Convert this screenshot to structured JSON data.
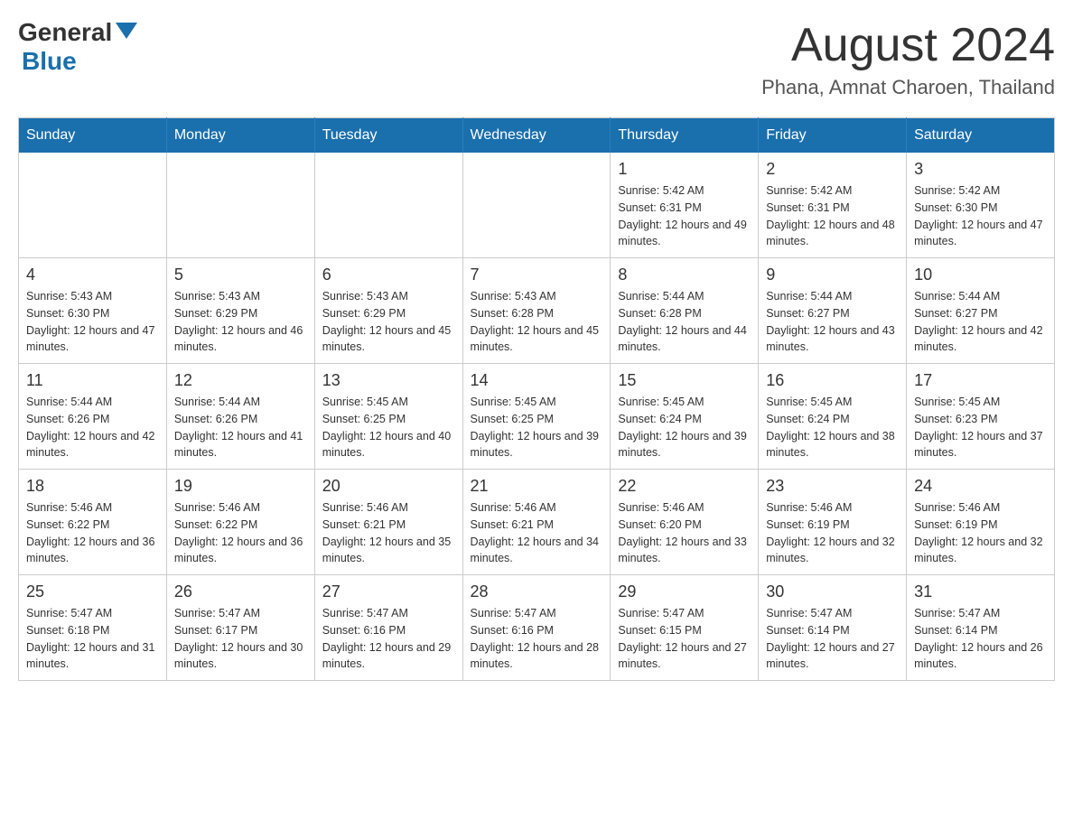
{
  "header": {
    "logo_general": "General",
    "logo_blue": "Blue",
    "title": "August 2024",
    "location": "Phana, Amnat Charoen, Thailand"
  },
  "weekdays": [
    "Sunday",
    "Monday",
    "Tuesday",
    "Wednesday",
    "Thursday",
    "Friday",
    "Saturday"
  ],
  "weeks": [
    [
      {
        "day": "",
        "info": ""
      },
      {
        "day": "",
        "info": ""
      },
      {
        "day": "",
        "info": ""
      },
      {
        "day": "",
        "info": ""
      },
      {
        "day": "1",
        "info": "Sunrise: 5:42 AM\nSunset: 6:31 PM\nDaylight: 12 hours and 49 minutes."
      },
      {
        "day": "2",
        "info": "Sunrise: 5:42 AM\nSunset: 6:31 PM\nDaylight: 12 hours and 48 minutes."
      },
      {
        "day": "3",
        "info": "Sunrise: 5:42 AM\nSunset: 6:30 PM\nDaylight: 12 hours and 47 minutes."
      }
    ],
    [
      {
        "day": "4",
        "info": "Sunrise: 5:43 AM\nSunset: 6:30 PM\nDaylight: 12 hours and 47 minutes."
      },
      {
        "day": "5",
        "info": "Sunrise: 5:43 AM\nSunset: 6:29 PM\nDaylight: 12 hours and 46 minutes."
      },
      {
        "day": "6",
        "info": "Sunrise: 5:43 AM\nSunset: 6:29 PM\nDaylight: 12 hours and 45 minutes."
      },
      {
        "day": "7",
        "info": "Sunrise: 5:43 AM\nSunset: 6:28 PM\nDaylight: 12 hours and 45 minutes."
      },
      {
        "day": "8",
        "info": "Sunrise: 5:44 AM\nSunset: 6:28 PM\nDaylight: 12 hours and 44 minutes."
      },
      {
        "day": "9",
        "info": "Sunrise: 5:44 AM\nSunset: 6:27 PM\nDaylight: 12 hours and 43 minutes."
      },
      {
        "day": "10",
        "info": "Sunrise: 5:44 AM\nSunset: 6:27 PM\nDaylight: 12 hours and 42 minutes."
      }
    ],
    [
      {
        "day": "11",
        "info": "Sunrise: 5:44 AM\nSunset: 6:26 PM\nDaylight: 12 hours and 42 minutes."
      },
      {
        "day": "12",
        "info": "Sunrise: 5:44 AM\nSunset: 6:26 PM\nDaylight: 12 hours and 41 minutes."
      },
      {
        "day": "13",
        "info": "Sunrise: 5:45 AM\nSunset: 6:25 PM\nDaylight: 12 hours and 40 minutes."
      },
      {
        "day": "14",
        "info": "Sunrise: 5:45 AM\nSunset: 6:25 PM\nDaylight: 12 hours and 39 minutes."
      },
      {
        "day": "15",
        "info": "Sunrise: 5:45 AM\nSunset: 6:24 PM\nDaylight: 12 hours and 39 minutes."
      },
      {
        "day": "16",
        "info": "Sunrise: 5:45 AM\nSunset: 6:24 PM\nDaylight: 12 hours and 38 minutes."
      },
      {
        "day": "17",
        "info": "Sunrise: 5:45 AM\nSunset: 6:23 PM\nDaylight: 12 hours and 37 minutes."
      }
    ],
    [
      {
        "day": "18",
        "info": "Sunrise: 5:46 AM\nSunset: 6:22 PM\nDaylight: 12 hours and 36 minutes."
      },
      {
        "day": "19",
        "info": "Sunrise: 5:46 AM\nSunset: 6:22 PM\nDaylight: 12 hours and 36 minutes."
      },
      {
        "day": "20",
        "info": "Sunrise: 5:46 AM\nSunset: 6:21 PM\nDaylight: 12 hours and 35 minutes."
      },
      {
        "day": "21",
        "info": "Sunrise: 5:46 AM\nSunset: 6:21 PM\nDaylight: 12 hours and 34 minutes."
      },
      {
        "day": "22",
        "info": "Sunrise: 5:46 AM\nSunset: 6:20 PM\nDaylight: 12 hours and 33 minutes."
      },
      {
        "day": "23",
        "info": "Sunrise: 5:46 AM\nSunset: 6:19 PM\nDaylight: 12 hours and 32 minutes."
      },
      {
        "day": "24",
        "info": "Sunrise: 5:46 AM\nSunset: 6:19 PM\nDaylight: 12 hours and 32 minutes."
      }
    ],
    [
      {
        "day": "25",
        "info": "Sunrise: 5:47 AM\nSunset: 6:18 PM\nDaylight: 12 hours and 31 minutes."
      },
      {
        "day": "26",
        "info": "Sunrise: 5:47 AM\nSunset: 6:17 PM\nDaylight: 12 hours and 30 minutes."
      },
      {
        "day": "27",
        "info": "Sunrise: 5:47 AM\nSunset: 6:16 PM\nDaylight: 12 hours and 29 minutes."
      },
      {
        "day": "28",
        "info": "Sunrise: 5:47 AM\nSunset: 6:16 PM\nDaylight: 12 hours and 28 minutes."
      },
      {
        "day": "29",
        "info": "Sunrise: 5:47 AM\nSunset: 6:15 PM\nDaylight: 12 hours and 27 minutes."
      },
      {
        "day": "30",
        "info": "Sunrise: 5:47 AM\nSunset: 6:14 PM\nDaylight: 12 hours and 27 minutes."
      },
      {
        "day": "31",
        "info": "Sunrise: 5:47 AM\nSunset: 6:14 PM\nDaylight: 12 hours and 26 minutes."
      }
    ]
  ]
}
